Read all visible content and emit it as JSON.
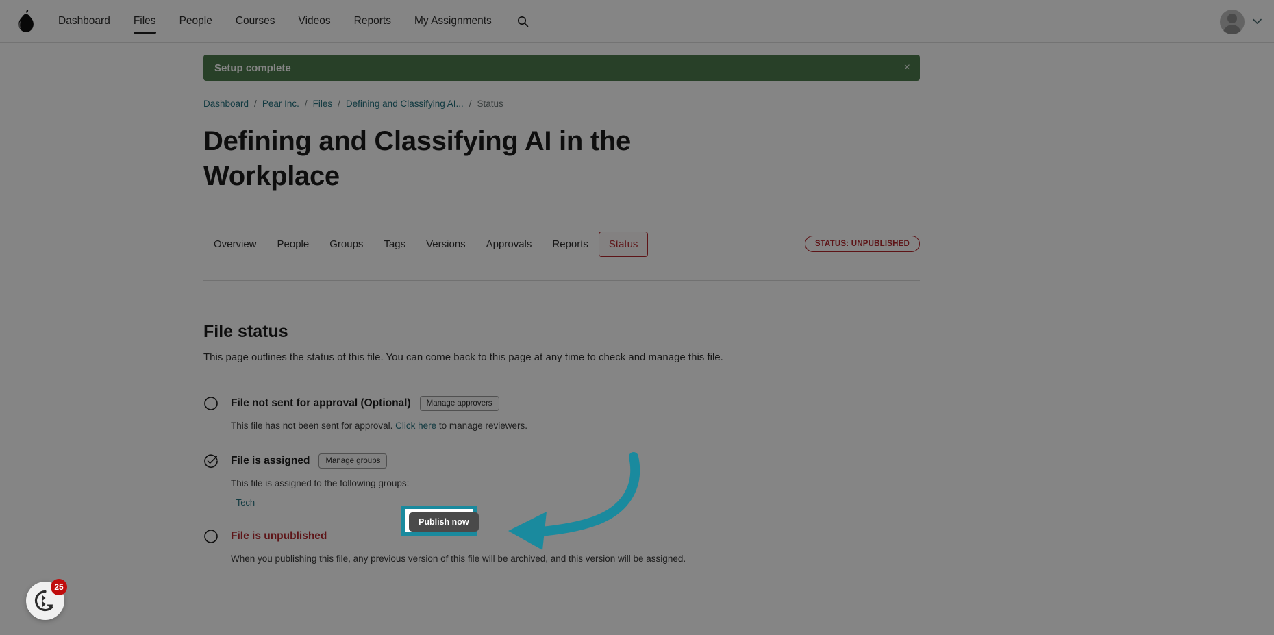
{
  "topnav": {
    "logo_icon": "pear-logo-icon",
    "links": [
      {
        "label": "Dashboard",
        "active": false
      },
      {
        "label": "Files",
        "active": true
      },
      {
        "label": "People",
        "active": false
      },
      {
        "label": "Courses",
        "active": false
      },
      {
        "label": "Videos",
        "active": false
      },
      {
        "label": "Reports",
        "active": false
      },
      {
        "label": "My Assignments",
        "active": false
      }
    ],
    "search_icon": "search-icon",
    "account_chevron_icon": "chevron-down-icon"
  },
  "banner": {
    "text": "Setup complete",
    "close_label": "×",
    "color": "#4d7c4d"
  },
  "breadcrumb": {
    "items": [
      {
        "label": "Dashboard",
        "link": true
      },
      {
        "label": "Pear Inc.",
        "link": true
      },
      {
        "label": "Files",
        "link": true
      },
      {
        "label": "Defining and Classifying AI...",
        "link": true
      },
      {
        "label": "Status",
        "link": false
      }
    ],
    "separator": "/"
  },
  "page": {
    "title": "Defining and Classifying AI in the Workplace"
  },
  "tabs": {
    "items": [
      {
        "label": "Overview",
        "active": false
      },
      {
        "label": "People",
        "active": false
      },
      {
        "label": "Groups",
        "active": false
      },
      {
        "label": "Tags",
        "active": false
      },
      {
        "label": "Versions",
        "active": false
      },
      {
        "label": "Approvals",
        "active": false
      },
      {
        "label": "Reports",
        "active": false
      },
      {
        "label": "Status",
        "active": true
      }
    ],
    "status_badge": "STATUS: UNPUBLISHED",
    "status_badge_color": "#b3282d"
  },
  "section": {
    "title": "File status",
    "subtitle": "This page outlines the status of this file. You can come back to this page at any time to check and manage this file."
  },
  "status_items": [
    {
      "icon": "circle-empty-icon",
      "label": "File not sent for approval (Optional)",
      "danger": false,
      "button": "Manage approvers",
      "desc_before": "This file has not been sent for approval. ",
      "desc_link": "Click here",
      "desc_after": " to manage reviewers."
    },
    {
      "icon": "circle-check-icon",
      "label": "File is assigned",
      "danger": false,
      "button": "Manage groups",
      "desc_before": "This file is assigned to the following groups:",
      "desc_link": "",
      "desc_after": "",
      "groups": "- Tech"
    },
    {
      "icon": "circle-empty-icon",
      "label": "File is unpublished",
      "danger": true,
      "button": "Publish now",
      "desc_before": "When you publishing this file, any previous version of this file will be archived, and this version will be assigned.",
      "desc_link": "",
      "desc_after": ""
    }
  ],
  "highlight": {
    "color": "#1a8a9e",
    "target": "Publish now"
  },
  "help_widget": {
    "badge_count": "25",
    "icon": "help-chat-icon"
  }
}
